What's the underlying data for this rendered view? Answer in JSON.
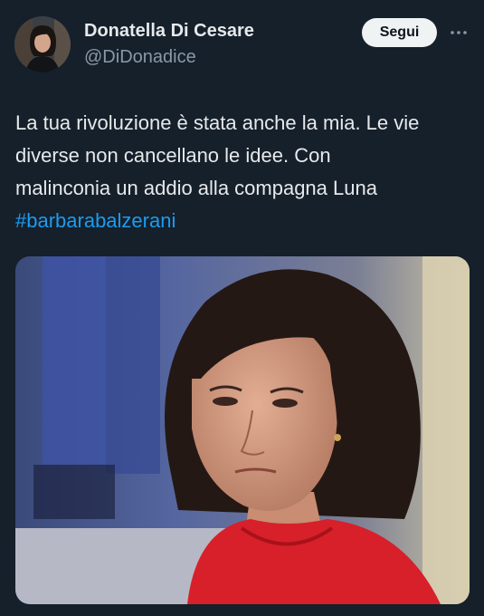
{
  "author": {
    "display_name": "Donatella Di Cesare",
    "handle": "@DiDonadice",
    "avatar_icon": "profile-photo"
  },
  "actions": {
    "follow_label": "Segui",
    "more_icon": "more-horizontal-icon"
  },
  "tweet": {
    "lines": [
      "La tua rivoluzione è stata anche la mia. Le vie",
      "diverse non cancellano le idee. Con",
      "malinconia un addio alla compagna Luna"
    ],
    "hashtag": "#barbarabalzerani"
  },
  "media": {
    "type": "photo",
    "subject": "woman-portrait"
  },
  "colors": {
    "background": "#15202b",
    "hashtag": "#1d9bf0",
    "handle": "#8b98a5"
  }
}
